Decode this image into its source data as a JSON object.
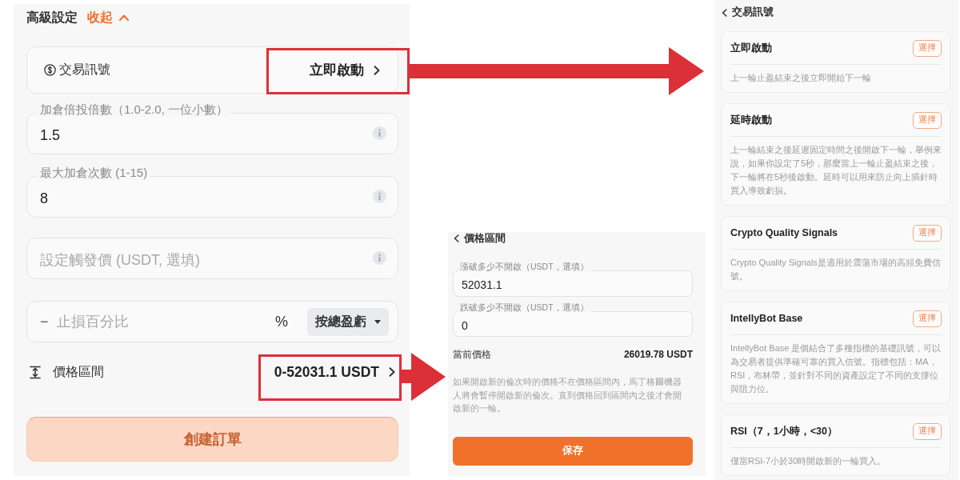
{
  "advanced_settings": {
    "title": "高級設定",
    "toggle": "收起",
    "expanded": true
  },
  "signal_row": {
    "label": "交易訊號",
    "value": "立即啟動",
    "highlighted": true
  },
  "fields": [
    {
      "label": "加倉倍投倍數（1.0-2.0, 一位小數）",
      "value": "1.5"
    },
    {
      "label": "最大加倉次數 (1-15)",
      "value": "8"
    },
    {
      "placeholder": "設定觸發價 (USDT, 選填)"
    }
  ],
  "stop_loss": {
    "sign": "−",
    "placeholder": "止損百分比",
    "unit": "%",
    "mode": "按總盈虧"
  },
  "price_range_row": {
    "label": "價格區間",
    "value": "0-52031.1 USDT",
    "highlighted": true
  },
  "submit_button": {
    "label": "創建訂單",
    "disabled": true
  },
  "price_range_page": {
    "title": "價格區間",
    "fields": [
      {
        "label": "漲破多少不開啟（USDT，選填）",
        "value": "52031.1"
      },
      {
        "label": "跌破多少不開啟（USDT，選填）",
        "value": "0"
      }
    ],
    "current_price": {
      "label": "當前價格",
      "value": "26019.78 USDT"
    },
    "note": "如果開啟新的倫次時的價格不在價格區間內，馬丁格爾機器人將會暫停開啟新的倫次。直到價格回到區間內之後才會開啟新的一輪。",
    "save_button": "保存"
  },
  "signal_page": {
    "title": "交易訊號",
    "options": [
      {
        "name": "立即啟動",
        "action": "選擇",
        "description": "上一輪止盈結束之後立即開始下一輪"
      },
      {
        "name": "延時啟動",
        "action": "選擇",
        "description": "上一輪結束之後延遲固定時間之後開啟下一輪，舉例來說，如果你設定了5秒，那麼當上一輪止盈結束之後，下一輪將在5秒後啟動。延時可以用來防止向上插針時買入導致虧損。"
      },
      {
        "name": "Crypto Quality Signals",
        "action": "選擇",
        "description": "Crypto Quality Signals是適用於震蕩市場的高頻免費信號。"
      },
      {
        "name": "IntellyBot Base",
        "action": "選擇",
        "description": "IntellyBot Base 是個結合了多種指標的基礎訊號，可以為交易者提供準確可靠的買入信號。指標包括：MA，RSI，布林帶，並針對不同的資產設定了不同的支撐位與阻力位。"
      },
      {
        "name": "RSI（7，1小時，<30）",
        "action": "選擇",
        "description": "僅當RSI-7小於30時開啟新的一輪買入。"
      }
    ]
  }
}
